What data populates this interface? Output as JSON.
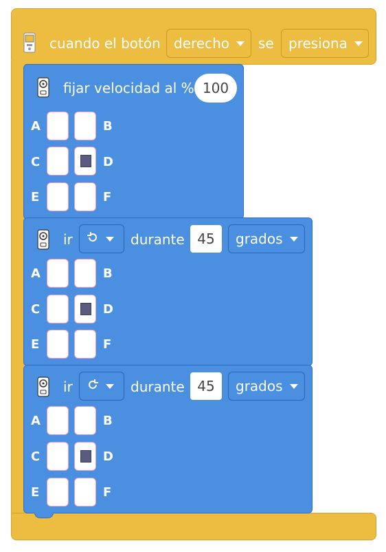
{
  "hat": {
    "text_when": "cuando el botón",
    "button_value": "derecho",
    "text_se": "se",
    "action_value": "presiona",
    "icon": "hub-icon"
  },
  "speed_block": {
    "label": "fijar velocidad al %",
    "value": "100",
    "icon": "motor-icon"
  },
  "move_blocks": [
    {
      "label_ir": "ir",
      "direction_icon": "rotate-ccw-icon",
      "label_during": "durante",
      "amount": "45",
      "unit": "grados"
    },
    {
      "label_ir": "ir",
      "direction_icon": "rotate-cw-icon",
      "label_during": "durante",
      "amount": "45",
      "unit": "grados"
    }
  ],
  "ports": {
    "A": "A",
    "B": "B",
    "C": "C",
    "D": "D",
    "E": "E",
    "F": "F",
    "selected": "D"
  },
  "colors": {
    "event_yellow": "#ecbd40",
    "motor_blue": "#4a8fe0",
    "port_selected": "#5b5a80"
  }
}
